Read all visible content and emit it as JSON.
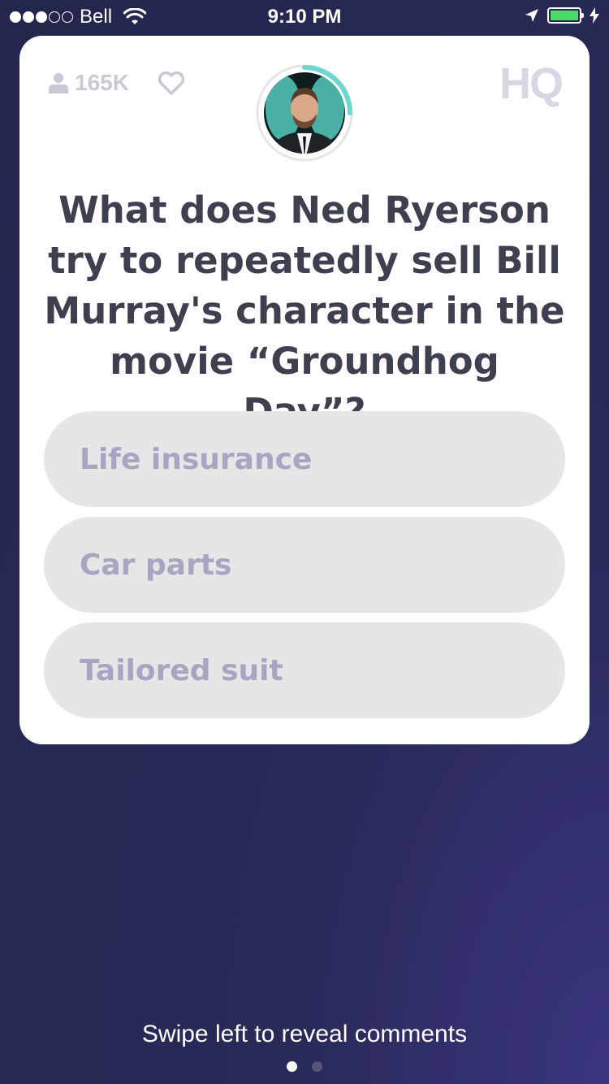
{
  "status_bar": {
    "carrier": "Bell",
    "time": "9:10 PM",
    "signal_bars_filled": 3,
    "signal_bars_total": 5,
    "battery_level": 1.0,
    "battery_color": "#4cd964"
  },
  "card": {
    "viewer_count": "165K",
    "logo": "HQ",
    "timer_progress": 0.25,
    "timer_color": "#6ad7d1",
    "question": "What does Ned Ryerson try to repeatedly sell Bill Murray's character in the movie “Groundhog Day”?",
    "answers": [
      {
        "label": "Life insurance"
      },
      {
        "label": "Car parts"
      },
      {
        "label": "Tailored suit"
      }
    ]
  },
  "footer": {
    "swipe_hint": "Swipe left to reveal comments",
    "page_count": 2,
    "active_page": 1
  },
  "icons": {
    "viewer": "person-icon",
    "favorite": "heart-icon",
    "location": "location-arrow-icon",
    "charging": "lightning-icon",
    "wifi": "wifi-icon"
  }
}
